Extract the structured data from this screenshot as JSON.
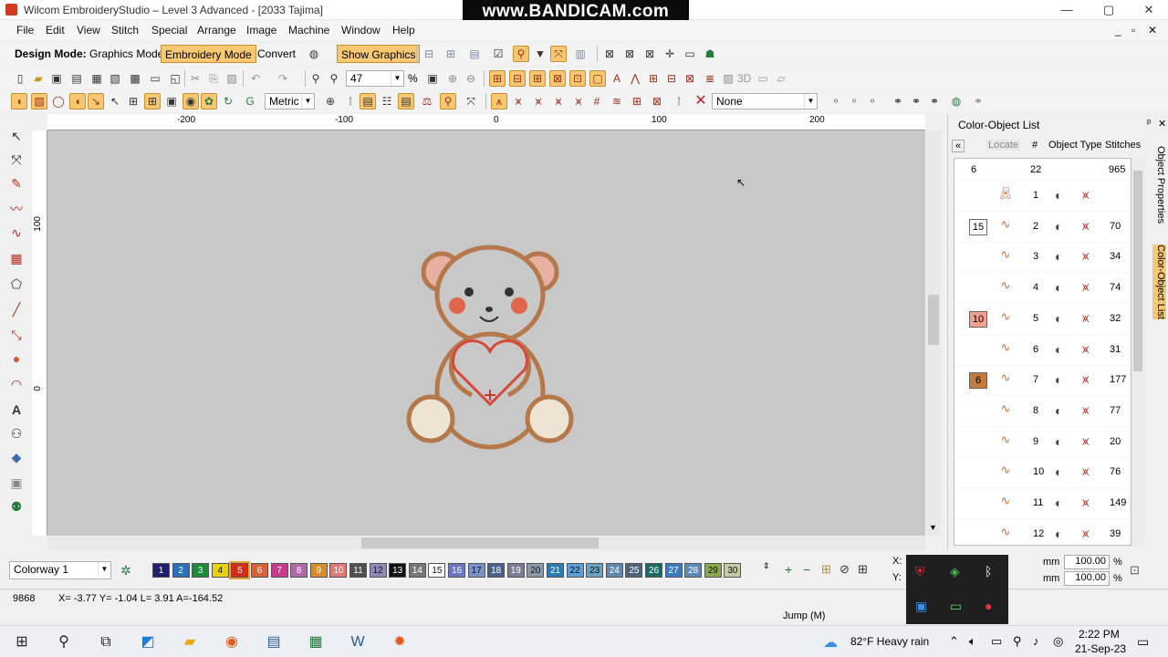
{
  "titlebar": {
    "title": "Wilcom EmbroideryStudio – Level 3 Advanced - [2033        Tajima]",
    "minimize": "—",
    "restore": "▢",
    "close": "✕"
  },
  "bandicam": "www.BANDICAM.com",
  "menu": {
    "file": "File",
    "edit": "Edit",
    "view": "View",
    "stitch": "Stitch",
    "special": "Special",
    "arrange": "Arrange",
    "image": "Image",
    "machine": "Machine",
    "window": "Window",
    "help": "Help",
    "mdi_min": "_",
    "mdi_restore": "▫",
    "mdi_close": "✕"
  },
  "modebar": {
    "label": "Design Mode:",
    "graphics": "Graphics Mode",
    "embroidery": "Embroidery Mode",
    "convert": "Convert",
    "show_graphics": "Show Graphics"
  },
  "toolbar2": {
    "zoom": "47",
    "percent": "%",
    "three_d": "3D"
  },
  "toolbar3": {
    "units": "Metric",
    "none": "None"
  },
  "ruler": {
    "top": [
      "-200",
      "-100",
      "0",
      "100",
      "200"
    ],
    "left": [
      "100",
      "0"
    ]
  },
  "panel": {
    "title": "Color-Object List",
    "pin": "ᵖ",
    "close": "✕",
    "header": {
      "locate": "Locate",
      "num": "#",
      "type": "Object Type",
      "stitches": "Stitches"
    },
    "summary": {
      "colors": "6",
      "objects": "22",
      "stitches": "965"
    },
    "rows": [
      {
        "group": "",
        "num": "1",
        "stitches": ""
      },
      {
        "group": "15",
        "num": "2",
        "stitches": "70"
      },
      {
        "group": "",
        "num": "3",
        "stitches": "34"
      },
      {
        "group": "",
        "num": "4",
        "stitches": "74"
      },
      {
        "group": "10",
        "num": "5",
        "stitches": "32"
      },
      {
        "group": "",
        "num": "6",
        "stitches": "31"
      },
      {
        "group": "6",
        "num": "7",
        "stitches": "177"
      },
      {
        "group": "",
        "num": "8",
        "stitches": "77"
      },
      {
        "group": "",
        "num": "9",
        "stitches": "20"
      },
      {
        "group": "",
        "num": "10",
        "stitches": "76"
      },
      {
        "group": "",
        "num": "11",
        "stitches": "149"
      },
      {
        "group": "",
        "num": "12",
        "stitches": "39"
      }
    ],
    "tabs": {
      "props": "Object Properties",
      "colorlist": "Color-Object List"
    }
  },
  "colorway": {
    "label": "Colorway 1",
    "swatches": [
      "1",
      "2",
      "3",
      "4",
      "5",
      "6",
      "7",
      "8",
      "9",
      "10",
      "11",
      "12",
      "13",
      "14",
      "15",
      "16",
      "17",
      "18",
      "19",
      "20",
      "21",
      "22",
      "23",
      "24",
      "25",
      "26",
      "27",
      "28",
      "29",
      "30"
    ]
  },
  "scale": {
    "x": "X:",
    "y": "Y:",
    "mm1": "mm",
    "mm2": "mm",
    "v1": "100.00",
    "v2": "100.00",
    "pct1": "%",
    "pct2": "%"
  },
  "status": {
    "stitch": "9868",
    "coords": "X= -3.77 Y= -1.04 L= 3.91 A=-164.52",
    "mode": "Jump (M)"
  },
  "taskbar": {
    "weather": "82°F  Heavy rain",
    "time": "2:22 PM",
    "date": "21-Sep-23"
  },
  "colors": {
    "highlight": "#f7c873",
    "canvas": "#c8c8c8",
    "swatch_colors": [
      "#1f1f6b",
      "#2d6fb8",
      "#1c8a3a",
      "#e8d200",
      "#d42a1a",
      "#d7623a",
      "#c83c8a",
      "#b06aa8",
      "#d98c28",
      "#e07a78",
      "#505050",
      "#8d8ab8",
      "#111111",
      "#777777",
      "#ffffff",
      "#6a78c0",
      "#7a92c8",
      "#4a6088",
      "#7b7b96",
      "#8b9aab",
      "#2c7ab0",
      "#5c9ed8",
      "#6aa0c2",
      "#5e8ab0",
      "#50647a",
      "#1d6b60",
      "#3b7abe",
      "#5c8ab8",
      "#8aa84c",
      "#c9c9a8"
    ]
  }
}
